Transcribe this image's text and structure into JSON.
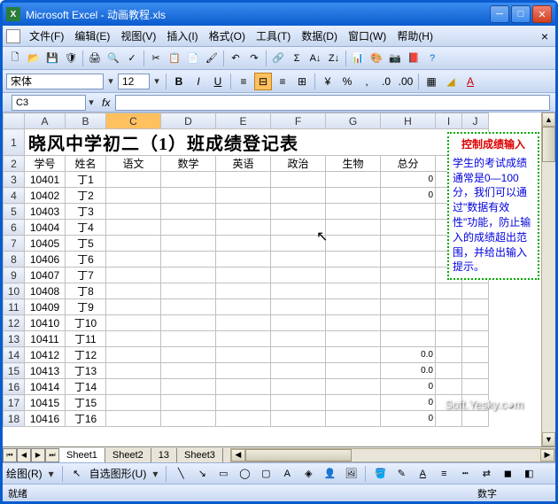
{
  "window": {
    "title": "Microsoft Excel - 动画教程.xls"
  },
  "menu": {
    "file": "文件(F)",
    "edit": "编辑(E)",
    "view": "视图(V)",
    "insert": "插入(I)",
    "format": "格式(O)",
    "tools": "工具(T)",
    "data": "数据(D)",
    "window_m": "窗口(W)",
    "help": "帮助(H)"
  },
  "format": {
    "font_name": "宋体",
    "font_size": "12"
  },
  "namebox": "C3",
  "columns": [
    "A",
    "B",
    "C",
    "D",
    "E",
    "F",
    "G",
    "H",
    "I",
    "J"
  ],
  "sheet": {
    "title": "晓风中学初二（1）班成绩登记表",
    "headers": {
      "id": "学号",
      "name": "姓名",
      "c1": "语文",
      "c2": "数学",
      "c3": "英语",
      "c4": "政治",
      "c5": "生物",
      "total": "总分"
    },
    "rows": [
      {
        "id": "10401",
        "name": "丁1",
        "h": "0"
      },
      {
        "id": "10402",
        "name": "丁2",
        "h": "0"
      },
      {
        "id": "10403",
        "name": "丁3",
        "h": ""
      },
      {
        "id": "10404",
        "name": "丁4",
        "h": ""
      },
      {
        "id": "10405",
        "name": "丁5",
        "h": ""
      },
      {
        "id": "10406",
        "name": "丁6",
        "h": ""
      },
      {
        "id": "10407",
        "name": "丁7",
        "h": ""
      },
      {
        "id": "10408",
        "name": "丁8",
        "h": ""
      },
      {
        "id": "10409",
        "name": "丁9",
        "h": ""
      },
      {
        "id": "10410",
        "name": "丁10",
        "h": ""
      },
      {
        "id": "10411",
        "name": "丁11",
        "h": ""
      },
      {
        "id": "10412",
        "name": "丁12",
        "h": "0.0"
      },
      {
        "id": "10413",
        "name": "丁13",
        "h": "0.0"
      },
      {
        "id": "10414",
        "name": "丁14",
        "h": "0"
      },
      {
        "id": "10415",
        "name": "丁15",
        "h": "0"
      },
      {
        "id": "10416",
        "name": "丁16",
        "h": "0"
      }
    ]
  },
  "callout": {
    "title": "控制成绩输入",
    "body": "学生的考试成绩通常是0—100分，我们可以通过\"数据有效性\"功能，防止输入的成绩超出范围，并给出输入提示。"
  },
  "tabs": {
    "s1": "Sheet1",
    "s2": "Sheet2",
    "s13": "13",
    "s3": "Sheet3"
  },
  "drawbar": {
    "label": "绘图(R)",
    "autoshape": "自选图形(U)"
  },
  "status": {
    "ready": "就绪",
    "num": "数字"
  },
  "watermark": "Soft.Yesky.c●m"
}
